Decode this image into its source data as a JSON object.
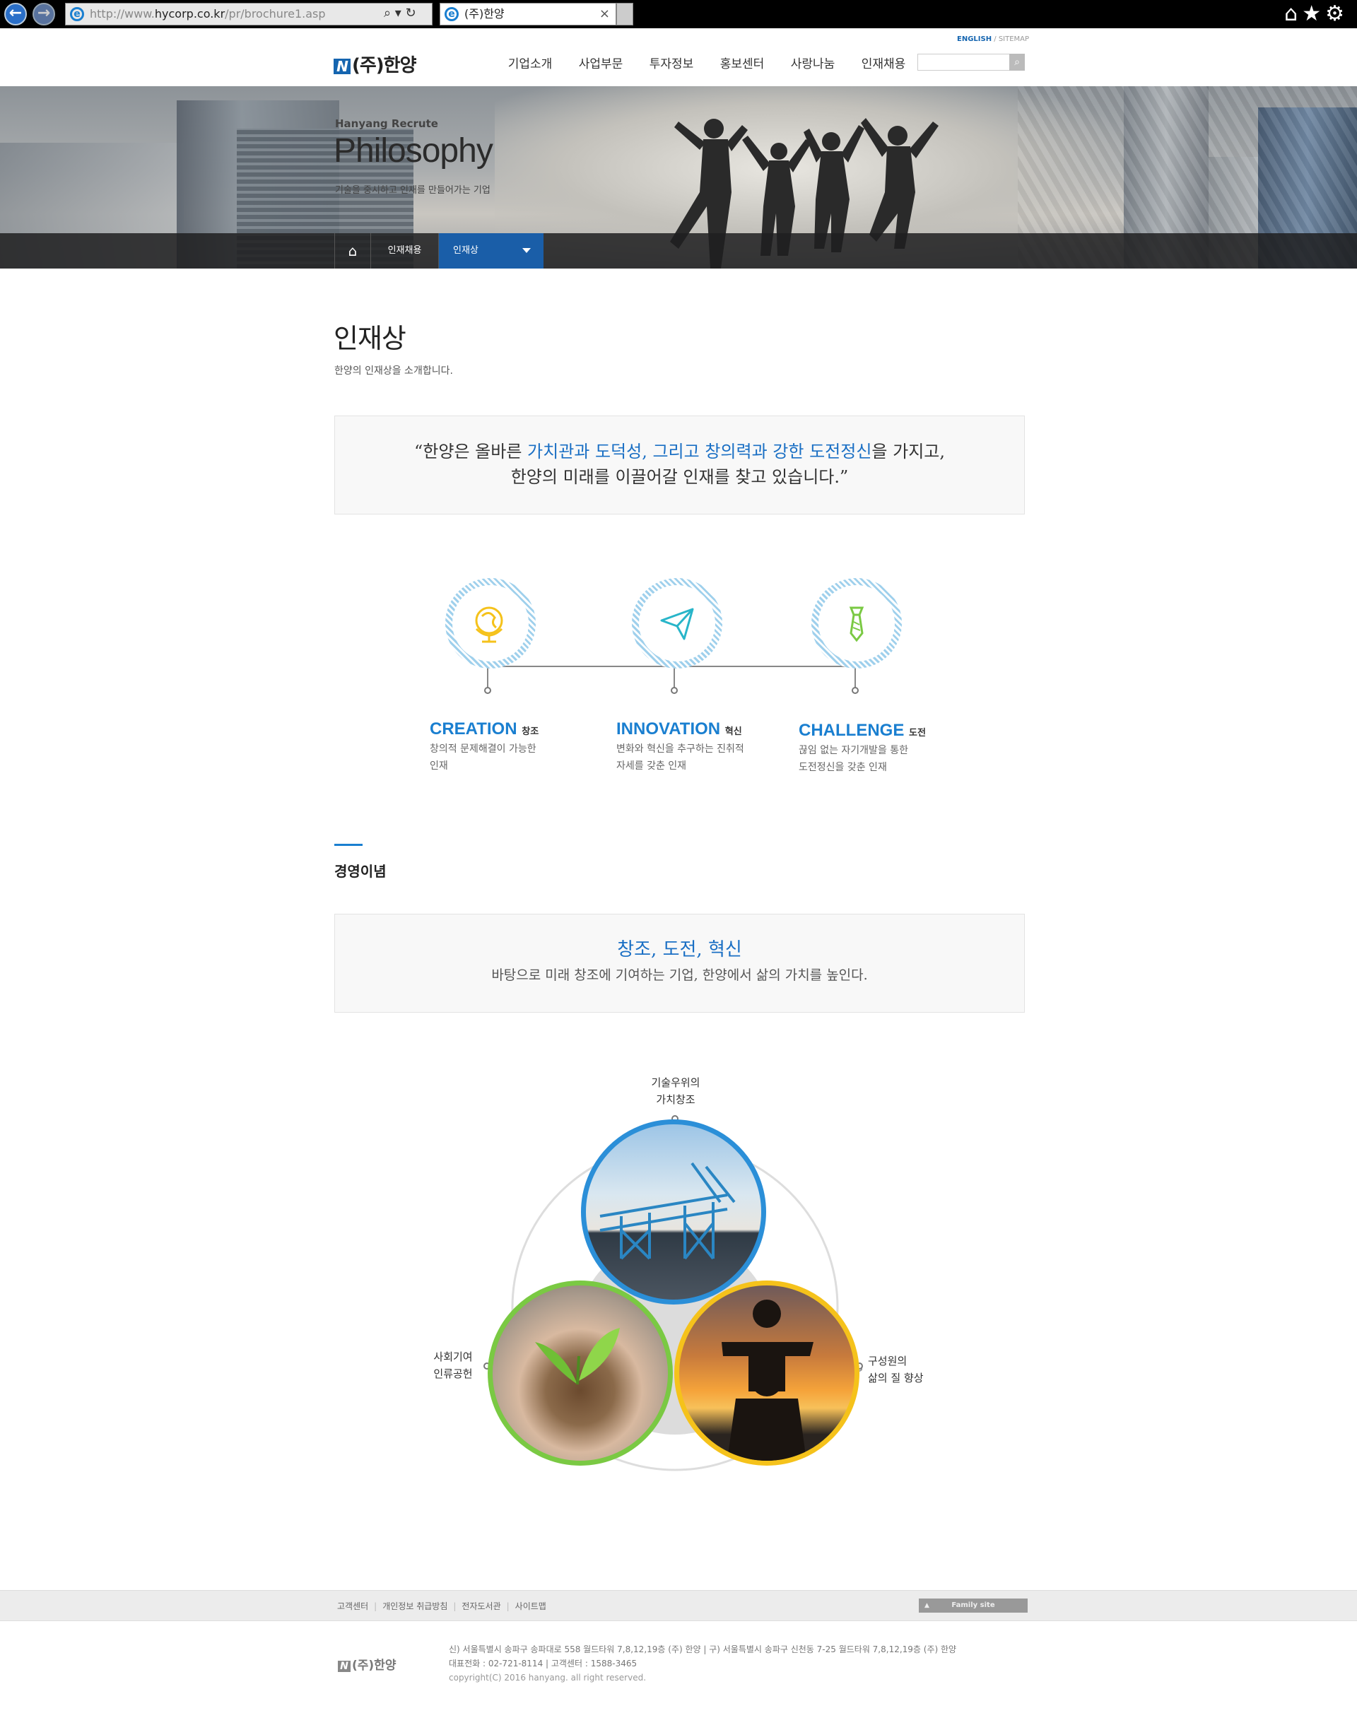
{
  "browser": {
    "url_prefix": "http://www.",
    "url_domain": "hycorp.co.kr",
    "url_path": "/pr/brochure1.asp",
    "tab_title": "(주)한양"
  },
  "header": {
    "logo_mark": "N",
    "logo_text": "(주)한양",
    "top_links": {
      "english": "ENGLISH",
      "sitemap": "SITEMAP",
      "sep": " / "
    },
    "nav": [
      "기업소개",
      "사업부문",
      "투자정보",
      "홍보센터",
      "사랑나눔",
      "인재채용"
    ],
    "search_placeholder": ""
  },
  "hero": {
    "subtitle": "Hanyang Recrute",
    "title": "Philosophy",
    "description": "기술을 중시하고 인재를 만들어가는 기업",
    "breadcrumb": [
      "인재채용",
      "인재상"
    ]
  },
  "page": {
    "title": "인재상",
    "description": "한양의 인재상을 소개합니다.",
    "quote": {
      "open": "“한양은 올바른 ",
      "hl1": "가치관과 도덕성, 그리고 창의력과 강한 도전정신",
      "mid": "을 가지고,",
      "line2": "한양의 미래를 이끌어갈 인재를 찾고 있습니다.”"
    }
  },
  "values": [
    {
      "title": "CREATION",
      "ko": "창조",
      "desc1": "창의적 문제해결이 가능한",
      "desc2": "인재",
      "icon": "globe-icon"
    },
    {
      "title": "INNOVATION",
      "ko": "혁신",
      "desc1": "변화와 혁신을 추구하는 진취적",
      "desc2": "자세를 갖춘 인재",
      "icon": "paper-plane-icon"
    },
    {
      "title": "CHALLENGE",
      "ko": "도전",
      "desc1": "끊임 없는 자기개발을 통한",
      "desc2": "도전정신을 갖춘 인재",
      "icon": "tie-icon"
    }
  ],
  "management": {
    "title": "경영이념",
    "headline": "창조, 도전, 혁신",
    "text": "바탕으로 미래 창조에 기여하는 기업, 한양에서 삶의 가치를 높인다.",
    "labels": {
      "top1": "기술우위의",
      "top2": "가치창조",
      "left1": "사회기여",
      "left2": "인류공헌",
      "right1": "구성원의",
      "right2": "삶의 질 향상"
    }
  },
  "footer": {
    "links": [
      "고객센터",
      "개인정보 취급방침",
      "전자도서관",
      "사이트맵"
    ],
    "family_site": "Family site",
    "logo_text": "(주)한양",
    "address": "신) 서울특별시 송파구 송파대로 558 월드타워 7,8,12,19층 (주) 한양  |  구) 서울특별시 송파구 신천동 7-25 월드타워 7,8,12,19층 (주) 한양",
    "phone": "대표전화 : 02-721-8114  |  고객센터 : 1588-3465",
    "copyright": "copyright(C) 2016 hanyang. all right reserved."
  },
  "colors": {
    "accent": "#1a7fd0",
    "lnb_active": "#1a5ea8",
    "green": "#7ac943",
    "yellow": "#f5c21b",
    "blue_ring": "#2b8fd8"
  }
}
